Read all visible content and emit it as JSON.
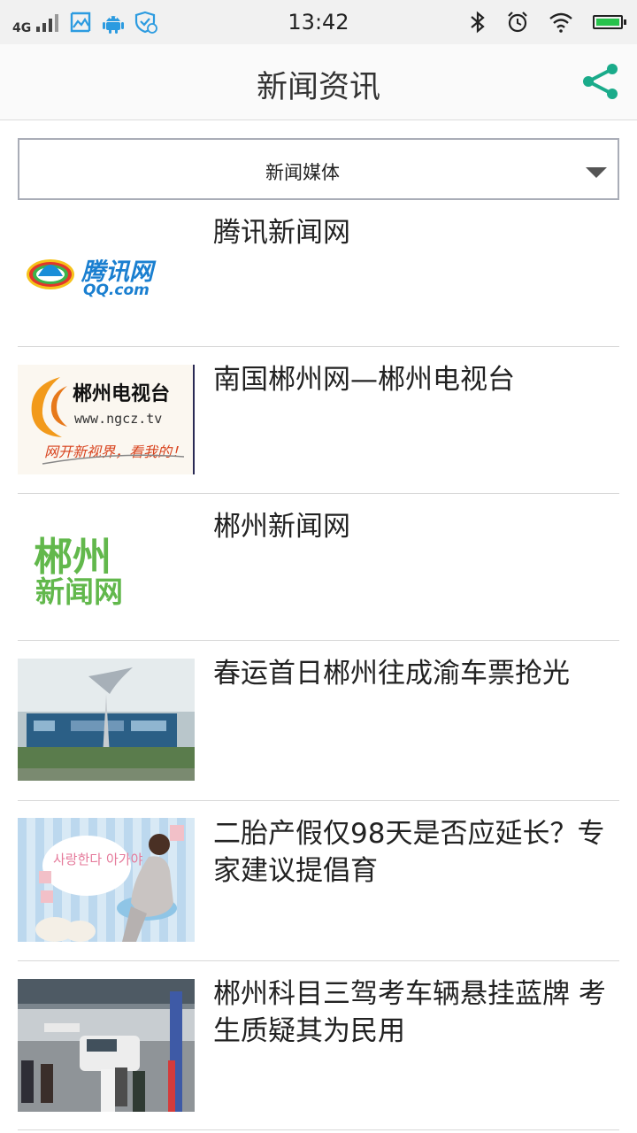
{
  "status_bar": {
    "network": "4G",
    "time": "13:42",
    "left_icons": [
      "image-icon",
      "android-icon",
      "shield-icon"
    ],
    "right_icons": [
      "bluetooth-icon",
      "alarm-icon",
      "wifi-icon",
      "battery-icon"
    ],
    "battery_level": 1.0
  },
  "header": {
    "title": "新闻资讯",
    "share_icon": "share-icon",
    "accent": "#1aab8a"
  },
  "filter": {
    "selected": "新闻媒体"
  },
  "news": [
    {
      "title": "腾讯新闻网",
      "logo_text": "腾讯网",
      "logo_sub": "QQ.com"
    },
    {
      "title": "南国郴州网—郴州电视台",
      "logo_text": "郴州电视台",
      "logo_sub": "www.ngcz.tv",
      "logo_slogan": "网开新视界，看我的！"
    },
    {
      "title": "郴州新闻网",
      "logo_text": "郴州",
      "logo_sub": "新闻网"
    },
    {
      "title": "春运首日郴州往成渝车票抢光"
    },
    {
      "title": "二胎产假仅98天是否应延长？专家建议提倡育",
      "photo_text": "사랑한다 아가야"
    },
    {
      "title": "郴州科目三驾考车辆悬挂蓝牌 考生质疑其为民用"
    }
  ]
}
